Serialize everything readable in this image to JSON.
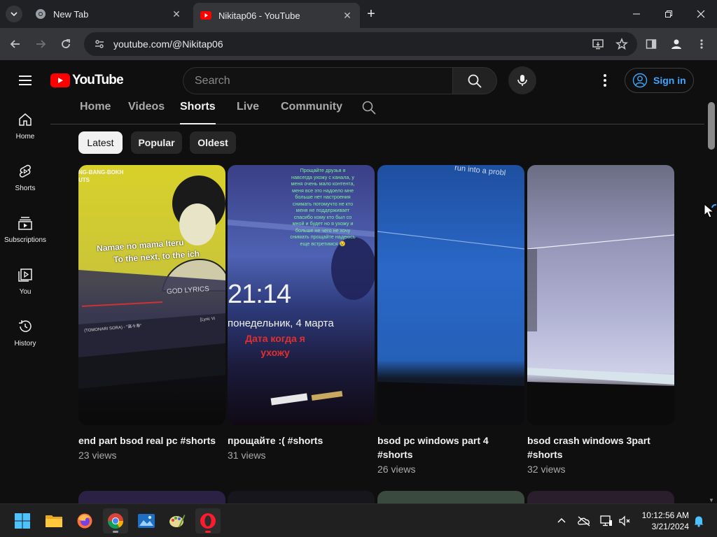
{
  "browser": {
    "tabs": [
      {
        "title": "New Tab",
        "active": false
      },
      {
        "title": "Nikitap06 - YouTube",
        "active": true
      }
    ],
    "url": "youtube.com/@Nikitap06"
  },
  "youtube": {
    "logo_text": "YouTube",
    "search_placeholder": "Search",
    "sign_in_label": "Sign in",
    "guide": [
      {
        "label": "Home",
        "icon": "home-icon"
      },
      {
        "label": "Shorts",
        "icon": "shorts-icon"
      },
      {
        "label": "Subscriptions",
        "icon": "subscriptions-icon"
      },
      {
        "label": "You",
        "icon": "you-icon"
      },
      {
        "label": "History",
        "icon": "history-icon"
      }
    ],
    "channel_tabs": [
      "Home",
      "Videos",
      "Shorts",
      "Live",
      "Community"
    ],
    "selected_tab": "Shorts",
    "chips": [
      "Latest",
      "Popular",
      "Oldest"
    ],
    "selected_chip": "Latest",
    "shorts": [
      {
        "title": "end part bsod real pc #shorts",
        "views": "23 views",
        "overlay": [
          "NG-BANG-BOKH",
          "UTS",
          "Namae no mama Iteru",
          "To the next, to the ich",
          "GOD LYRICS",
          "(TOMONARI SORA) - \"高々寿\"",
          "[Lyric Vi"
        ]
      },
      {
        "title": "прощайте :( #shorts",
        "views": "31 views",
        "overlay_note": "Прощайте друзья я навсегда ухожу с канала, у меня очень мало контента, меня все это надоело мне больше нет настроения снимать потомучто не кто меня не поддерживает спасибо кому кто был со мной и будет но я ухожу и больше не чего не хочу снимать прощайте надеюсь еще встретимся 😢",
        "overlay_time": "21:14",
        "overlay_date": "понедельник, 4 марта",
        "overlay_caption": "Дата когда я ухожу"
      },
      {
        "title": "bsod pc windows part 4 #shorts",
        "views": "26 views",
        "overlay": [
          "run into a probl"
        ]
      },
      {
        "title": "bsod crash windows 3part #shorts",
        "views": "32 views"
      }
    ]
  },
  "taskbar": {
    "apps": [
      "start-icon",
      "file-explorer-icon",
      "firefox-icon",
      "chrome-icon",
      "photos-icon",
      "paint-icon",
      "opera-icon"
    ],
    "time": "10:12:56 AM",
    "date": "3/21/2024"
  },
  "colors": {
    "yt_red": "#ff0000",
    "link_blue": "#3ea6ff",
    "bg": "#0f0f0f"
  }
}
